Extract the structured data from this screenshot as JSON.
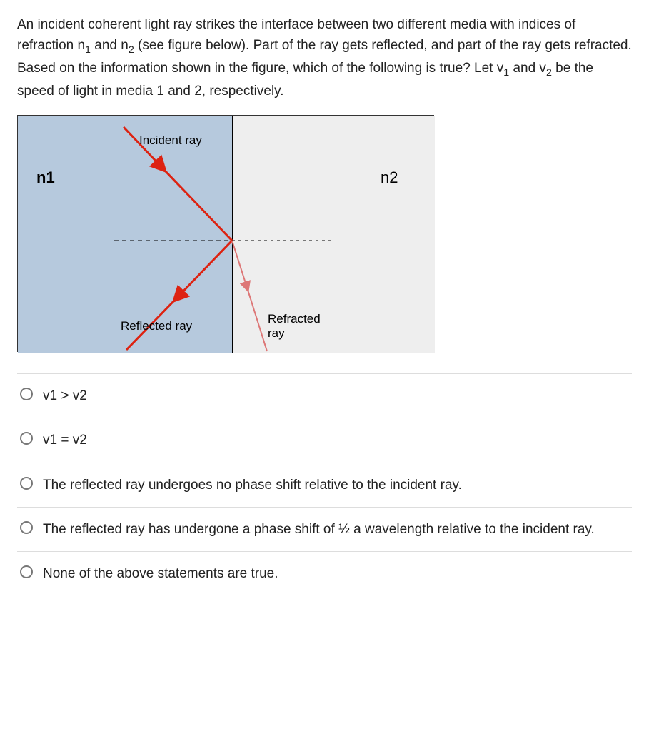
{
  "question": {
    "p1": "An incident coherent light ray strikes the interface between two different media with indices of refraction n",
    "sub1": "1",
    "p2": " and n",
    "sub2": "2",
    "p3": " (see figure below).  Part of the ray gets reflected, and part of the ray gets refracted.  Based on the information shown in the figure, which of the following is true?  Let v",
    "sub3": "1",
    "p4": " and v",
    "sub4": "2",
    "p5": " be the speed of light in media 1 and 2, respectively."
  },
  "figure": {
    "n1_label": "n1",
    "n2_label": "n2",
    "incident_label": "Incident ray",
    "reflected_label": "Reflected ray",
    "refracted_label1": "Refracted",
    "refracted_label2": "ray"
  },
  "options": [
    {
      "text": "v1 > v2"
    },
    {
      "text": "v1 = v2"
    },
    {
      "text": "The reflected ray undergoes no phase shift relative to the incident ray."
    },
    {
      "text": "The reflected ray has undergone a phase shift of ½ a wavelength relative to the incident ray."
    },
    {
      "text": "None of the above statements are true."
    }
  ]
}
